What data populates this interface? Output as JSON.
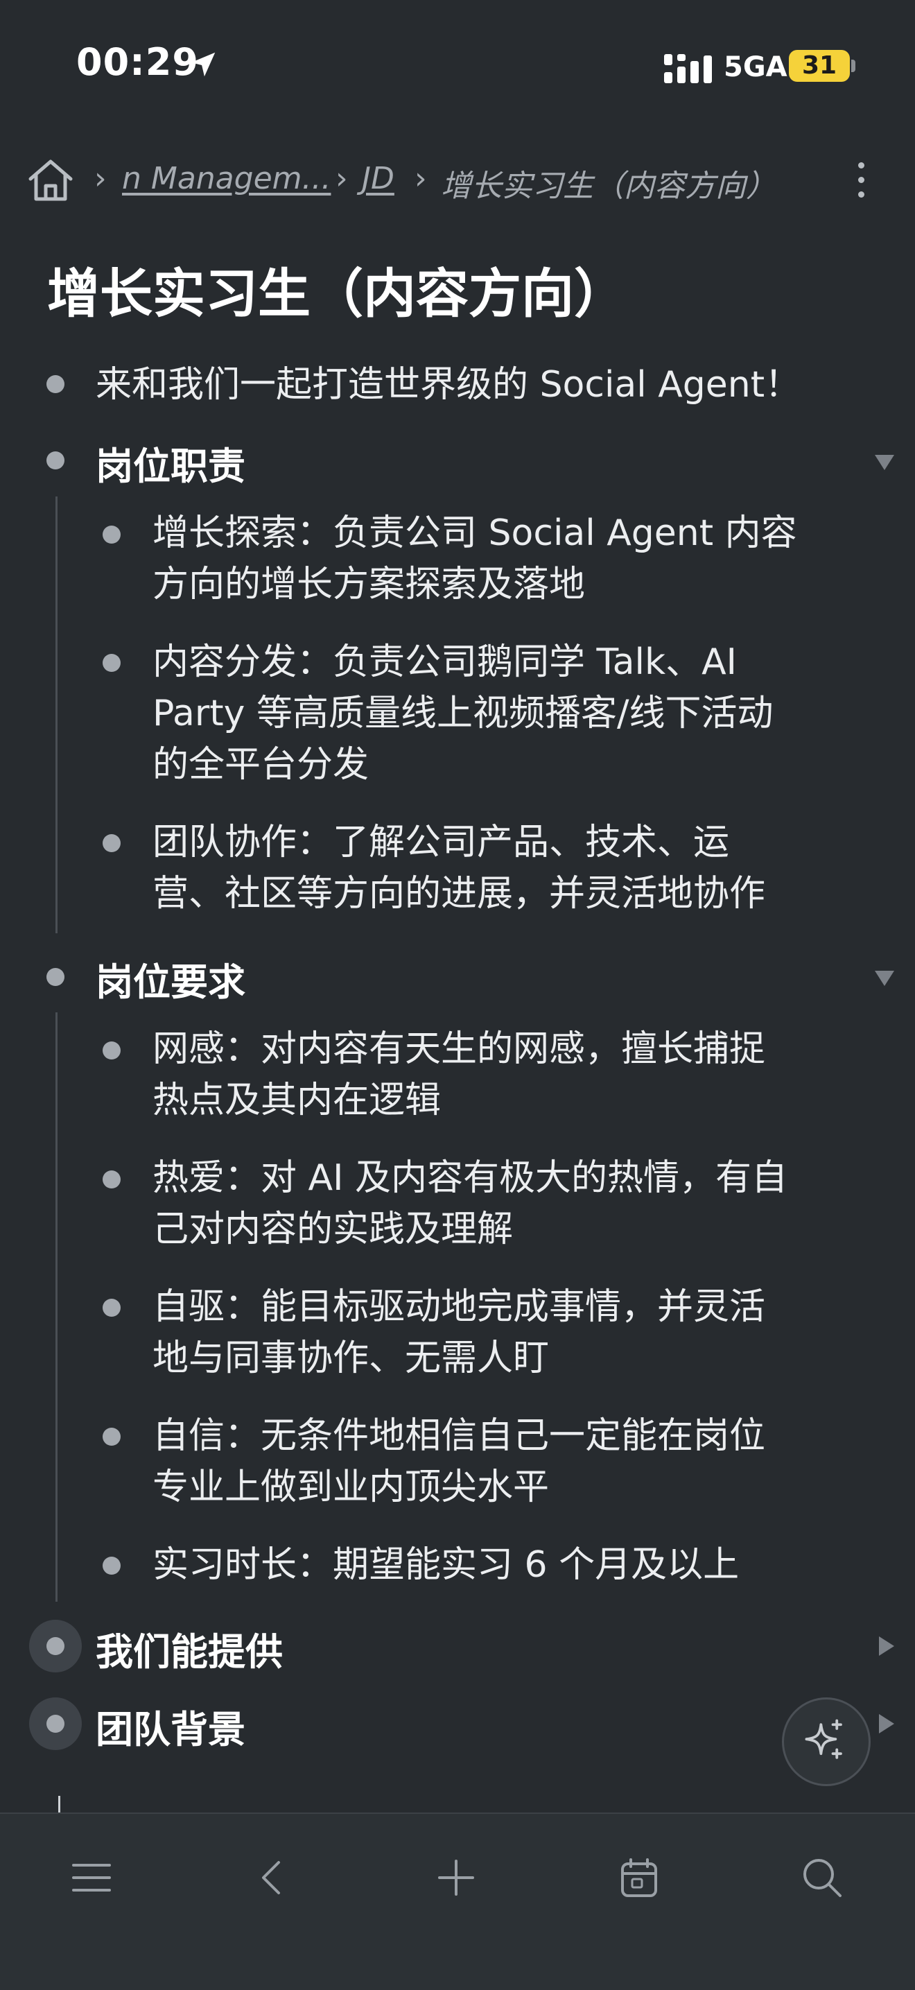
{
  "status_bar": {
    "time": "00:29",
    "network": "5GA",
    "battery": "31"
  },
  "breadcrumb": {
    "items": [
      "n Managem...",
      "JD",
      "增长实习生（内容方向）"
    ]
  },
  "page": {
    "title": "增长实习生（内容方向）"
  },
  "outline": {
    "intro": "来和我们一起打造世界级的 Social Agent！",
    "sections": [
      {
        "heading": "岗位职责",
        "items": [
          [
            "增长探索：负责公司 Social Agent 内容",
            "方向的增长方案探索及落地"
          ],
          [
            "内容分发：负责公司鹅同学 Talk、AI",
            "Party 等高质量线上视频播客/线下活动",
            "的全平台分发"
          ],
          [
            "团队协作：了解公司产品、技术、运",
            "营、社区等方向的进展，并灵活地协作"
          ]
        ]
      },
      {
        "heading": "岗位要求",
        "items": [
          [
            "网感：对内容有天生的网感，擅长捕捉",
            "热点及其内在逻辑"
          ],
          [
            "热爱：对 AI 及内容有极大的热情，有自",
            "己对内容的实践及理解"
          ],
          [
            "自驱：能目标驱动地完成事情，并灵活",
            "地与同事协作、无需人盯"
          ],
          [
            "自信：无条件地相信自己一定能在岗位",
            "专业上做到业内顶尖水平"
          ],
          [
            "实习时长：期望能实习 6 个月及以上"
          ]
        ]
      },
      {
        "heading": "我们能提供"
      },
      {
        "heading": "团队背景"
      }
    ]
  },
  "toolbar": {
    "icons": [
      "menu-icon",
      "back-icon",
      "add-icon",
      "calendar-icon",
      "search-icon"
    ]
  },
  "colors": {
    "background": "#272b2f",
    "text": "#eceef0",
    "muted": "#a6abb1",
    "battery": "#f5d23a"
  }
}
